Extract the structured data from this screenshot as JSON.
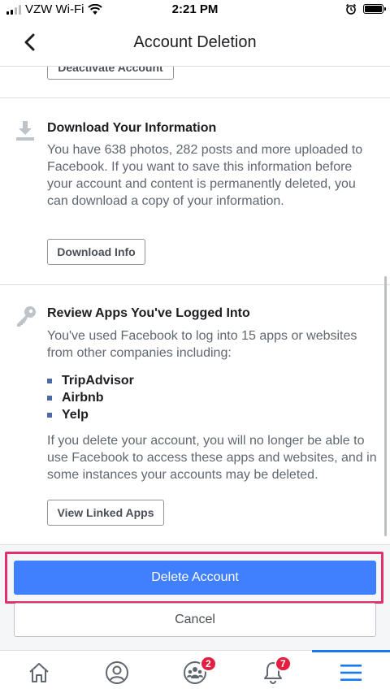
{
  "status_bar": {
    "carrier": "VZW Wi-Fi",
    "time": "2:21 PM"
  },
  "header": {
    "title": "Account Deletion"
  },
  "partial_section": {
    "button_label": "Deactivate Account"
  },
  "download_section": {
    "title": "Download Your Information",
    "description": "You have 638 photos, 282 posts and more uploaded to Facebook. If you want to save this information before your account and content is permanently deleted, you can download a copy of your information.",
    "button_label": "Download Info",
    "icon": "download-icon"
  },
  "apps_section": {
    "title": "Review Apps You've Logged Into",
    "description": "You've used Facebook to log into 15 apps or websites from other companies including:",
    "apps": [
      "TripAdvisor",
      "Airbnb",
      "Yelp"
    ],
    "warning": "If you delete your account, you will no longer be able to use Facebook to access these apps and websites, and in some instances your accounts may be deleted.",
    "button_label": "View Linked Apps",
    "icon": "key-icon"
  },
  "actions": {
    "primary_label": "Delete Account",
    "secondary_label": "Cancel"
  },
  "tab_bar": {
    "tabs": [
      {
        "name": "home",
        "icon": "home-icon",
        "badge": ""
      },
      {
        "name": "profile",
        "icon": "profile-icon",
        "badge": ""
      },
      {
        "name": "groups",
        "icon": "groups-icon",
        "badge": "2"
      },
      {
        "name": "notifications",
        "icon": "bell-icon",
        "badge": "7"
      },
      {
        "name": "menu",
        "icon": "hamburger-menu-icon",
        "badge": ""
      }
    ],
    "active": "menu"
  },
  "colors": {
    "accent": "#4080ff",
    "highlight": "#e0316e",
    "badge": "#e41e3f",
    "active_tab": "#1877f2"
  }
}
